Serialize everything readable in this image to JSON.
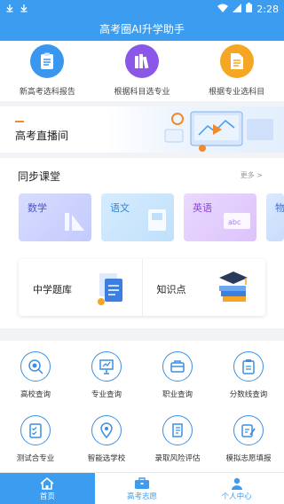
{
  "status_bar": {
    "time": "2:28"
  },
  "app": {
    "title": "高考圈AI升学助手"
  },
  "quick_actions": [
    {
      "label": "新高考选科报告",
      "icon": "report-icon",
      "color": "#3a97ef"
    },
    {
      "label": "根据科目选专业",
      "icon": "books-icon",
      "color": "#8a57e8"
    },
    {
      "label": "根据专业选科目",
      "icon": "document-icon",
      "color": "#f5a623"
    }
  ],
  "live": {
    "title": "高考直播间"
  },
  "course": {
    "title": "同步课堂",
    "more": "更多 >",
    "cards": [
      {
        "label": "数学",
        "icon": "ruler-triangle-icon"
      },
      {
        "label": "语文",
        "icon": "book-icon"
      },
      {
        "label": "英语",
        "icon": "abc-board-icon"
      },
      {
        "label": "物",
        "icon": "physics-icon"
      }
    ],
    "boxes": [
      {
        "label": "中学题库",
        "icon": "question-bank-icon"
      },
      {
        "label": "知识点",
        "icon": "graduation-books-icon"
      }
    ]
  },
  "tools": [
    {
      "label": "高校查询",
      "icon": "search-target-icon"
    },
    {
      "label": "专业查询",
      "icon": "presentation-icon"
    },
    {
      "label": "职业查询",
      "icon": "briefcase-icon"
    },
    {
      "label": "分数线查询",
      "icon": "clipboard-icon"
    },
    {
      "label": "测试合专业",
      "icon": "checklist-icon"
    },
    {
      "label": "智能选学校",
      "icon": "location-pin-icon"
    },
    {
      "label": "录取风险评估",
      "icon": "scroll-icon"
    },
    {
      "label": "模拟志愿填报",
      "icon": "edit-form-icon"
    }
  ],
  "tabbar": [
    {
      "label": "首页",
      "icon": "home-icon",
      "active": true
    },
    {
      "label": "高考志愿",
      "icon": "briefcase-icon",
      "active": false
    },
    {
      "label": "个人中心",
      "icon": "user-icon",
      "active": false
    }
  ],
  "colors": {
    "primary": "#3c9df0",
    "accent": "#f08a2c"
  }
}
